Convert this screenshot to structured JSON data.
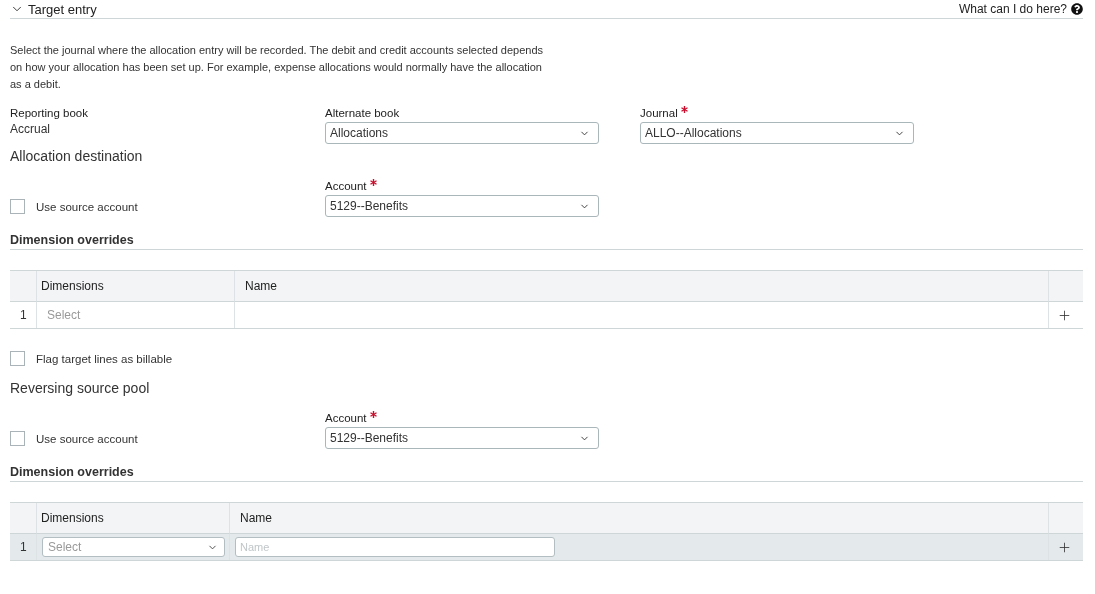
{
  "section": {
    "title": "Target entry",
    "expanded": true,
    "help_link": "What can I do here?"
  },
  "description": "Select the journal where the allocation entry will be recorded. The debit and credit accounts selected depends on how your allocation has been set up. For example, expense allocations would normally have the allocation as a debit.",
  "reporting_book": {
    "label": "Reporting book",
    "value": "Accrual"
  },
  "alternate_book": {
    "label": "Alternate book",
    "value": "Allocations"
  },
  "journal": {
    "label": "Journal",
    "value": "ALLO--Allocations",
    "required": true
  },
  "pools": [
    {
      "title": "Allocation destination",
      "use_source_account": {
        "label": "Use source account",
        "checked": false
      },
      "account": {
        "label": "Account",
        "value": "5129--Benefits",
        "required": true
      },
      "overrides": {
        "title": "Dimension overrides",
        "columns": [
          "Dimensions",
          "Name"
        ],
        "rows": [
          {
            "number": "1",
            "dimension": "Select",
            "editing": false
          }
        ]
      },
      "billable": {
        "label": "Flag target lines as billable",
        "checked": false
      }
    },
    {
      "title": "Reversing source pool",
      "use_source_account": {
        "label": "Use source account",
        "checked": false
      },
      "account": {
        "label": "Account",
        "value": "5129--Benefits",
        "required": true
      },
      "overrides": {
        "title": "Dimension overrides",
        "columns": [
          "Dimensions",
          "Name"
        ],
        "rows": [
          {
            "number": "1",
            "dimension": "Select",
            "name_placeholder": "Name",
            "editing": true
          }
        ]
      }
    }
  ]
}
